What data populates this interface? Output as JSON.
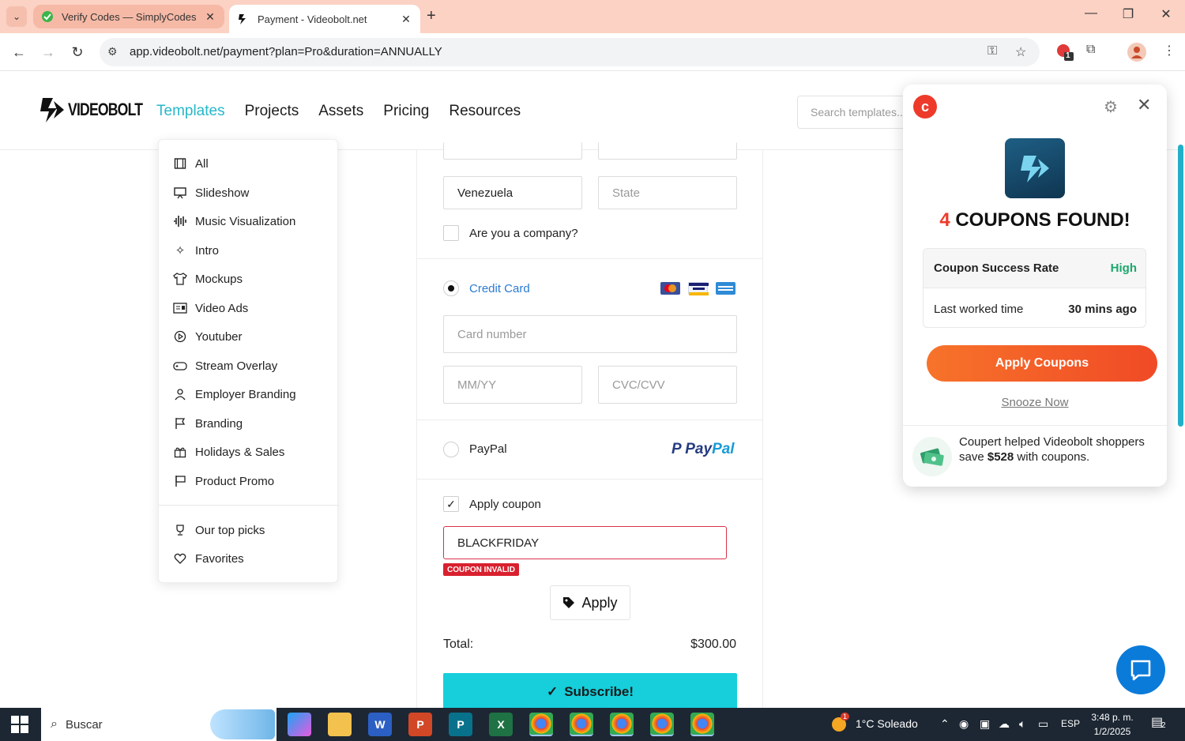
{
  "browser": {
    "tabs": [
      {
        "title": "Verify Codes — SimplyCodes",
        "active": false
      },
      {
        "title": "Payment - Videobolt.net",
        "active": true
      }
    ],
    "url": "app.videobolt.net/payment?plan=Pro&duration=ANNUALLY",
    "extension_badge": "1"
  },
  "site": {
    "logo_text": "VIDEOBOLT",
    "nav": [
      "Templates",
      "Projects",
      "Assets",
      "Pricing",
      "Resources"
    ],
    "search_placeholder": "Search templates..."
  },
  "templates_menu": {
    "items": [
      {
        "label": "All",
        "icon": "film-icon"
      },
      {
        "label": "Slideshow",
        "icon": "presentation-icon"
      },
      {
        "label": "Music Visualization",
        "icon": "audio-wave-icon"
      },
      {
        "label": "Intro",
        "icon": "sparkle-icon"
      },
      {
        "label": "Mockups",
        "icon": "shirt-icon"
      },
      {
        "label": "Video Ads",
        "icon": "ad-card-icon"
      },
      {
        "label": "Youtuber",
        "icon": "play-circle-icon"
      },
      {
        "label": "Stream Overlay",
        "icon": "gamepad-icon"
      },
      {
        "label": "Employer Branding",
        "icon": "person-icon"
      },
      {
        "label": "Branding",
        "icon": "flag-icon"
      },
      {
        "label": "Holidays & Sales",
        "icon": "gift-icon"
      },
      {
        "label": "Product Promo",
        "icon": "billboard-icon"
      }
    ],
    "extra": [
      {
        "label": "Our top picks",
        "icon": "trophy-icon"
      },
      {
        "label": "Favorites",
        "icon": "heart-icon"
      }
    ]
  },
  "form": {
    "country": "Venezuela",
    "state_placeholder": "State",
    "company_label": "Are you a company?",
    "credit_card_label": "Credit Card",
    "card_number_placeholder": "Card number",
    "expiry_placeholder": "MM/YY",
    "cvc_placeholder": "CVC/CVV",
    "paypal_label": "PayPal",
    "paypal_logo_a": "Pay",
    "paypal_logo_b": "Pal",
    "apply_coupon_label": "Apply coupon",
    "coupon_code": "BLACKFRIDAY",
    "coupon_status": "COUPON INVALID",
    "apply_button": "Apply",
    "total_label": "Total:",
    "total_value": "$300.00",
    "subscribe_button": "Subscribe!"
  },
  "coupert": {
    "count": "4",
    "headline": "COUPONS FOUND!",
    "success_rate_label": "Coupon Success Rate",
    "success_rate_value": "High",
    "last_worked_label": "Last worked time",
    "last_worked_value": "30 mins ago",
    "apply_button": "Apply Coupons",
    "snooze": "Snooze Now",
    "footer_a": "Coupert helped Videobolt shoppers save ",
    "footer_amount": "$528",
    "footer_b": " with coupons."
  },
  "taskbar": {
    "search_label": "Buscar",
    "weather_badge": "1",
    "weather": "1°C  Soleado",
    "language": "ESP",
    "time": "3:48 p. m.",
    "date": "1/2/2025",
    "notifications": "2"
  },
  "colors": {
    "accent": "#25b8c9",
    "subscribe": "#16cfdb",
    "error": "#d9202e",
    "coupert_orange": "#f04a26",
    "success_green": "#1aa86b"
  }
}
